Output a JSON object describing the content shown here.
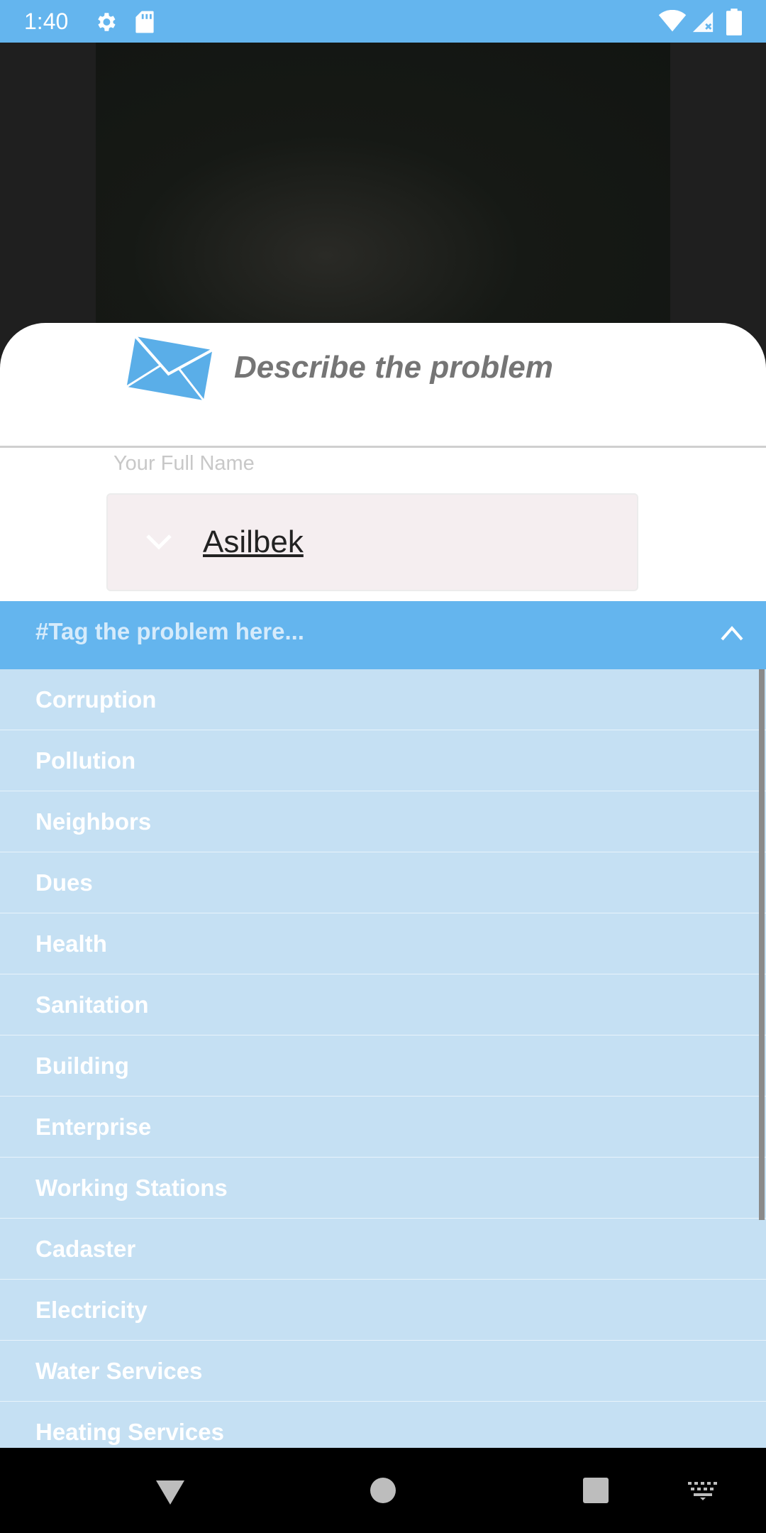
{
  "status_bar": {
    "time": "1:40",
    "icons": [
      "gear-icon",
      "sd-card-icon",
      "wifi-icon",
      "signal-icon",
      "battery-icon"
    ]
  },
  "sheet": {
    "title": "Describe the problem",
    "icon": "envelope-icon",
    "name_field": {
      "label": "Your Full Name",
      "value": "Asilbek"
    }
  },
  "tag_dropdown": {
    "placeholder": "#Tag the problem here...",
    "expanded": true,
    "options": [
      "Corruption",
      "Pollution",
      "Neighbors",
      "Dues",
      "Health",
      "Sanitation",
      "Building",
      "Enterprise",
      "Working Stations",
      "Cadaster",
      "Electricity",
      "Water Services",
      "Heating Services"
    ]
  },
  "nav_bar": {
    "icons": [
      "back-icon",
      "home-icon",
      "recents-icon",
      "keyboard-icon"
    ]
  },
  "colors": {
    "accent": "#64b5ee",
    "list_background": "#c5e0f3",
    "name_box_background": "#f5eef0"
  }
}
